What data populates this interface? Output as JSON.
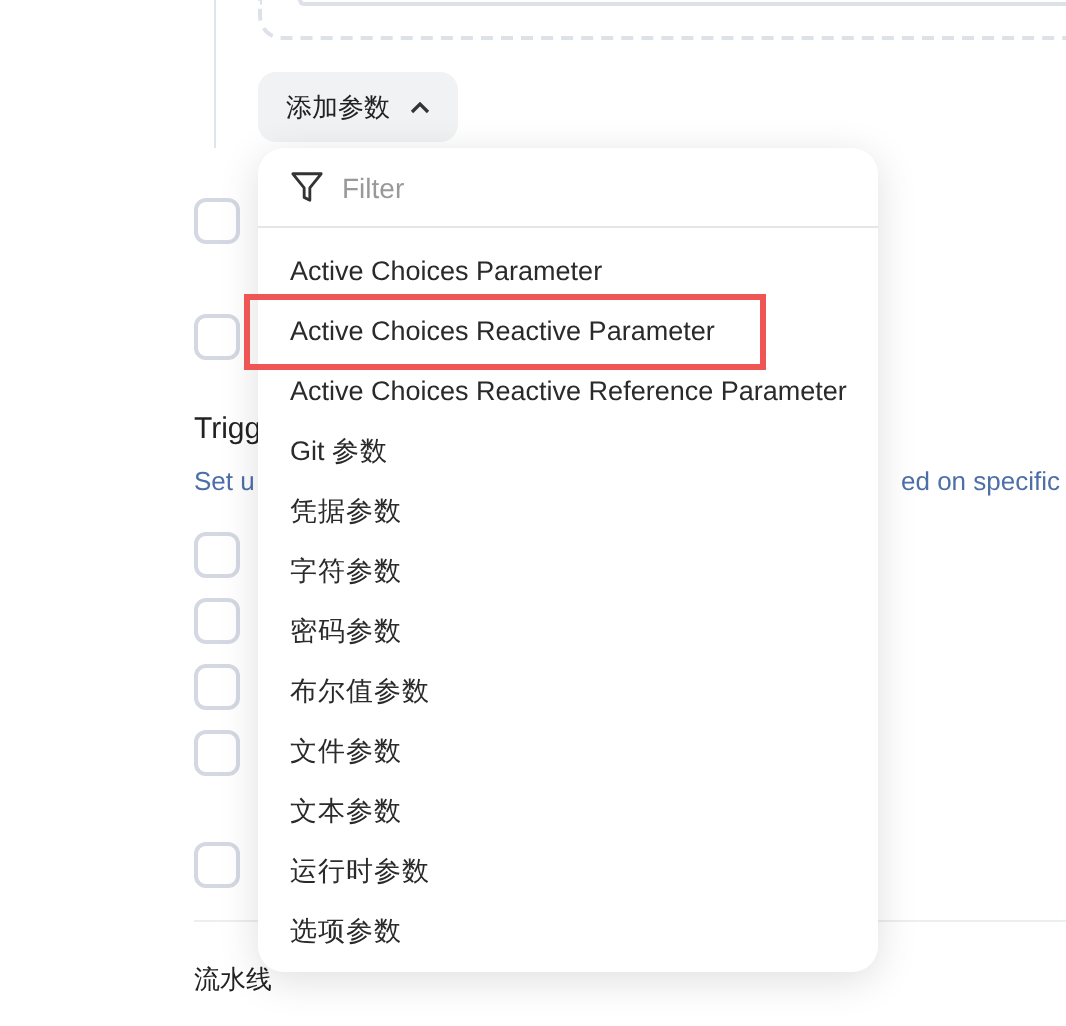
{
  "add_parameter_button": {
    "label": "添加参数",
    "expanded": true
  },
  "background_checkboxes_top": [
    {
      "checked": false
    },
    {
      "checked": false
    }
  ],
  "triggers": {
    "heading": "Trigg",
    "description_start": "Set u",
    "description_end": "ed on specific",
    "checkboxes": [
      {
        "checked": false
      },
      {
        "checked": false
      },
      {
        "checked": false
      },
      {
        "checked": false
      },
      {
        "checked": false
      }
    ]
  },
  "next_section_heading": "流水线",
  "dropdown": {
    "filter_placeholder": "Filter",
    "items": [
      {
        "label": "Active Choices Parameter",
        "selected": false
      },
      {
        "label": "Active Choices Reactive Parameter",
        "selected": true
      },
      {
        "label": "Active Choices Reactive Reference Parameter",
        "selected": false
      },
      {
        "label": "Git 参数",
        "selected": false
      },
      {
        "label": "凭据参数",
        "selected": false
      },
      {
        "label": "字符参数",
        "selected": false
      },
      {
        "label": "密码参数",
        "selected": false
      },
      {
        "label": "布尔值参数",
        "selected": false
      },
      {
        "label": "文件参数",
        "selected": false
      },
      {
        "label": "文本参数",
        "selected": false
      },
      {
        "label": "运行时参数",
        "selected": false
      },
      {
        "label": "选项参数",
        "selected": false
      }
    ]
  }
}
